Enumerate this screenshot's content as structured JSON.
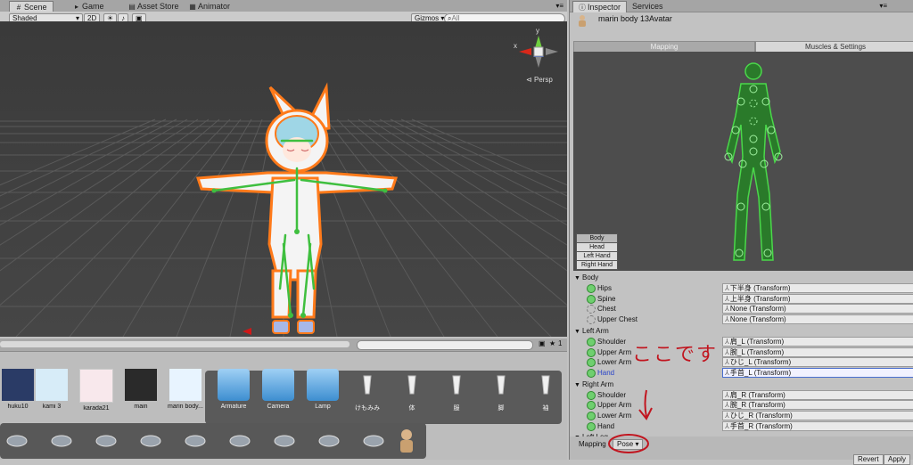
{
  "scene_tabs": [
    {
      "icon": "#",
      "label": "Scene"
    },
    {
      "icon": "▸",
      "label": "Game"
    },
    {
      "icon": "▤",
      "label": "Asset Store"
    },
    {
      "icon": "▦",
      "label": "Animator"
    }
  ],
  "scene_toolbar": {
    "shading": "Shaded",
    "mode_2d": "2D",
    "light_icon": "☀",
    "audio_icon": "♪",
    "fx_icon": "▣",
    "gizmos": "Gizmos",
    "search_placeholder": "All"
  },
  "scene": {
    "persp": "Persp",
    "axis_y": "y",
    "axis_x": "x"
  },
  "project": {
    "row1": [
      "huku10",
      "kami 3",
      "karada21",
      "main",
      "marin body...",
      "Armature",
      "Camera",
      "Lamp",
      "けもみみ",
      "体",
      "服",
      "脚",
      "袖"
    ],
    "row2_count": 9,
    "badge": "1"
  },
  "inspector": {
    "tabs": [
      "Inspector",
      "Services"
    ],
    "object_name": "marin body 13Avatar",
    "subtabs": [
      "Mapping",
      "Muscles & Settings"
    ],
    "side_buttons": [
      "Body",
      "Head",
      "Left Hand",
      "Right Hand"
    ],
    "groups": [
      {
        "title": "Body",
        "rows": [
          {
            "name": "Hips",
            "value": "下半身 (Transform)",
            "optional": false
          },
          {
            "name": "Spine",
            "value": "上半身 (Transform)",
            "optional": false
          },
          {
            "name": "Chest",
            "value": "None (Transform)",
            "optional": true
          },
          {
            "name": "Upper Chest",
            "value": "None (Transform)",
            "optional": true
          }
        ]
      },
      {
        "title": "Left Arm",
        "rows": [
          {
            "name": "Shoulder",
            "value": "肩_L (Transform)",
            "optional": false
          },
          {
            "name": "Upper Arm",
            "value": "腕_L (Transform)",
            "optional": false
          },
          {
            "name": "Lower Arm",
            "value": "ひじ_L (Transform)",
            "optional": false
          },
          {
            "name": "Hand",
            "value": "手首_L (Transform)",
            "optional": false
          }
        ]
      },
      {
        "title": "Right Arm",
        "rows": [
          {
            "name": "Shoulder",
            "value": "肩_R (Transform)",
            "optional": false
          },
          {
            "name": "Upper Arm",
            "value": "腕_R (Transform)",
            "optional": false
          },
          {
            "name": "Lower Arm",
            "value": "ひじ_R (Transform)",
            "optional": false
          },
          {
            "name": "Hand",
            "value": "手首_R (Transform)",
            "optional": false
          }
        ]
      },
      {
        "title": "Left Leg",
        "rows": []
      }
    ],
    "bottom": {
      "mapping": "Mapping",
      "pose": "Pose",
      "revert": "Revert",
      "apply": "Apply"
    }
  },
  "annotation": {
    "text": "ここです",
    "color": "#c1151f"
  },
  "colors": {
    "bone_green": "#3fbf3f",
    "outline_orange": "#ff7a1a",
    "selection_blue": "#4a6fcf"
  }
}
